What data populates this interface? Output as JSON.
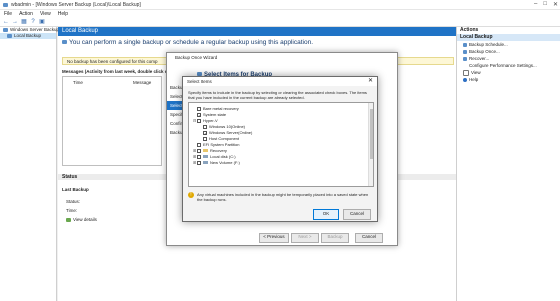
{
  "window": {
    "title": "wbadmin - [Windows Server Backup (Local)\\Local Backup]"
  },
  "menu": [
    "File",
    "Action",
    "View",
    "Help"
  ],
  "tree": {
    "items": [
      "Windows Server Backup (L...",
      "Local Backup"
    ]
  },
  "center": {
    "header": "Local Backup",
    "info": "You can perform a single backup or schedule a regular backup using this application.",
    "warning": "No backup has been configured for this comp",
    "messages_title": "Messages (Activity from last week, double click on",
    "columns": [
      "Time",
      "Message"
    ],
    "status_section": "Status",
    "last_backup_title": "Last Backup",
    "status_label": "Status:",
    "time_label": "Time:",
    "view_details": "View details"
  },
  "actions": {
    "header": "Actions",
    "group": "Local Backup",
    "items": [
      "Backup Schedule...",
      "Backup Once...",
      "Recover...",
      "Configure Performance Settings...",
      "View",
      "Help"
    ]
  },
  "wizard": {
    "title": "Backup Once Wizard",
    "heading": "Select Items for Backup",
    "steps": [
      "Backup Options",
      "Select Backup Configuration",
      "Select Items",
      "Specify Destination Type",
      "Confirmation",
      "Backup Progress"
    ],
    "steps_visible": [
      "Backup",
      "Select",
      "Select It",
      "Specify",
      "Confirm",
      "Backup"
    ],
    "buttons": [
      "< Previous",
      "Next >",
      "Backup",
      "Cancel"
    ]
  },
  "dialog": {
    "title": "Select Items",
    "info": "Specify items to include in the backup by selecting or clearing the associated check boxes. The items that you have included in the current backup are already selected.",
    "items": [
      {
        "label": "Bare metal recovery",
        "checked": false,
        "indent": 1,
        "type": "check"
      },
      {
        "label": "System state",
        "checked": true,
        "indent": 1,
        "type": "check"
      },
      {
        "label": "Hyper-V",
        "checked": false,
        "indent": 1,
        "type": "check",
        "expandable": true
      },
      {
        "label": "Windows 10(Online)",
        "checked": false,
        "indent": 2,
        "type": "check"
      },
      {
        "label": "Windows Server(Online)",
        "checked": true,
        "indent": 2,
        "type": "check"
      },
      {
        "label": "Host Component",
        "checked": false,
        "indent": 2,
        "type": "check"
      },
      {
        "label": "EFI System Partition",
        "checked": false,
        "indent": 1,
        "type": "check"
      },
      {
        "label": "Recovery",
        "checked": false,
        "indent": 0,
        "type": "folder"
      },
      {
        "label": "Local disk (C:)",
        "checked": false,
        "indent": 0,
        "type": "folder"
      },
      {
        "label": "New Volume (F:)",
        "checked": false,
        "indent": 0,
        "type": "folder"
      }
    ],
    "note": "Any virtual machines included in the backup might be temporarily placed into a saved state when the backup runs.",
    "ok": "OK",
    "cancel": "Cancel"
  },
  "colors": {
    "accent": "#1f73c6",
    "selection": "#cce4f7"
  }
}
